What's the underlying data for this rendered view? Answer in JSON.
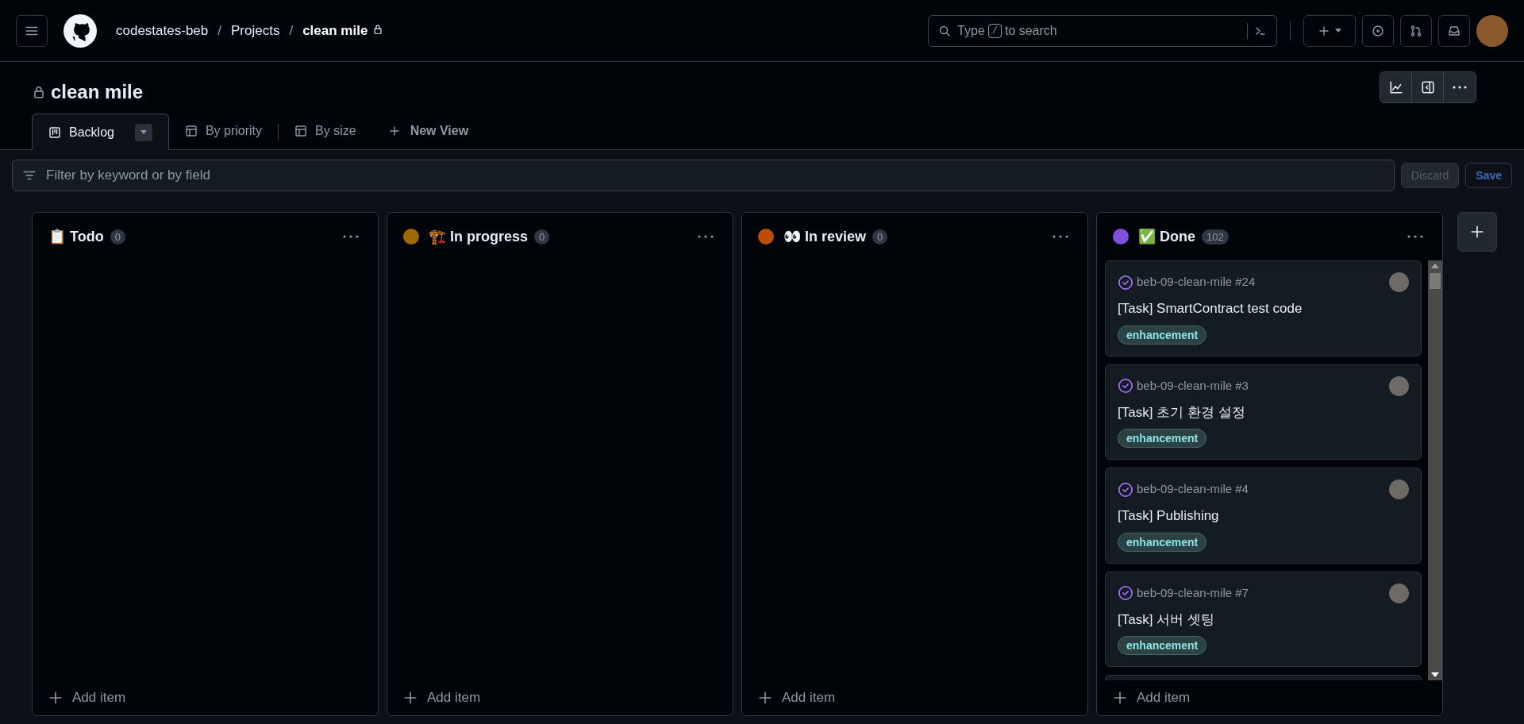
{
  "breadcrumbs": [
    {
      "label": "codestates-beb",
      "current": false
    },
    {
      "label": "Projects",
      "current": false
    },
    {
      "label": "clean mile",
      "current": true
    }
  ],
  "breadcrumb_separator": "/",
  "search": {
    "placeholder_before": "Type",
    "key": "/",
    "placeholder_after": "to search"
  },
  "project": {
    "title": "clean mile"
  },
  "views": [
    {
      "label": "Backlog",
      "kind": "board",
      "selected": true
    },
    {
      "label": "By priority",
      "kind": "table",
      "selected": false
    },
    {
      "label": "By size",
      "kind": "table",
      "selected": false
    }
  ],
  "new_view": "New View",
  "filter": {
    "placeholder": "Filter by keyword or by field"
  },
  "filter_buttons": {
    "discard": "Discard",
    "save": "Save"
  },
  "columns": [
    {
      "title": "📋 Todo",
      "count": "0",
      "add_item": "Add item"
    },
    {
      "title": "🏗️ In progress",
      "count": "0",
      "color": "#9e6a03",
      "add_item": "Add item"
    },
    {
      "title": "👀 In review",
      "count": "0",
      "color": "#bc4c00",
      "add_item": "Add item"
    },
    {
      "title": "✅ Done",
      "count": "102",
      "color": "#8250df",
      "add_item": "Add item",
      "cards": [
        {
          "repo": "beb-09-clean-mile #24",
          "title": "[Task] SmartContract test code",
          "label": "enhancement"
        },
        {
          "repo": "beb-09-clean-mile #3",
          "title": "[Task] 초기 환경 설정",
          "label": "enhancement"
        },
        {
          "repo": "beb-09-clean-mile #4",
          "title": "[Task] Publishing",
          "label": "enhancement"
        },
        {
          "repo": "beb-09-clean-mile #7",
          "title": "[Task] 서버 셋팅",
          "label": "enhancement"
        }
      ]
    }
  ]
}
